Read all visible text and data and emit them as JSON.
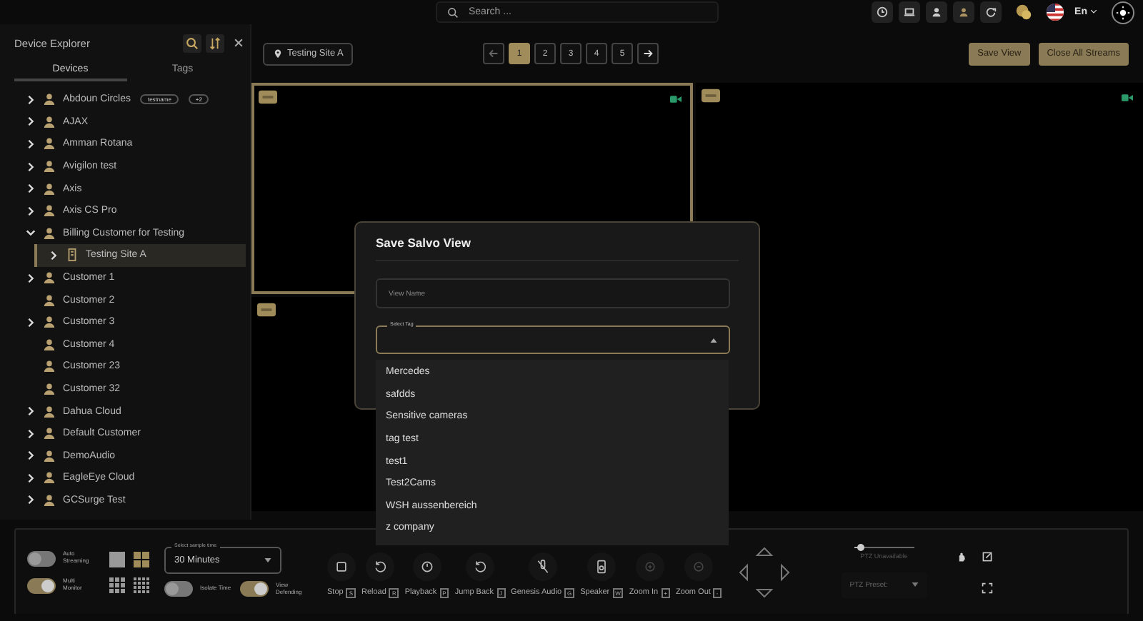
{
  "topbar": {
    "search_placeholder": "Search ...",
    "language": "En"
  },
  "sidebar": {
    "title": "Device Explorer",
    "tabs": [
      {
        "label": "Devices",
        "selected": true
      },
      {
        "label": "Tags",
        "selected": false
      }
    ],
    "tree": [
      {
        "label": "Abdoun Circles",
        "kind": "customer",
        "expandable": true,
        "expanded": false,
        "selected": false,
        "tags": [
          "testname",
          "+2"
        ]
      },
      {
        "label": "AJAX",
        "kind": "customer",
        "expandable": true,
        "expanded": false,
        "selected": false
      },
      {
        "label": "Amman Rotana",
        "kind": "customer",
        "expandable": true,
        "expanded": false,
        "selected": false
      },
      {
        "label": "Avigilon test",
        "kind": "customer",
        "expandable": true,
        "expanded": false,
        "selected": false
      },
      {
        "label": "Axis",
        "kind": "customer",
        "expandable": true,
        "expanded": false,
        "selected": false
      },
      {
        "label": "Axis CS Pro",
        "kind": "customer",
        "expandable": true,
        "expanded": false,
        "selected": false
      },
      {
        "label": "Billing Customer for Testing",
        "kind": "customer",
        "expandable": true,
        "expanded": true,
        "selected": false,
        "children": [
          {
            "label": "Testing Site A",
            "kind": "site",
            "expandable": true,
            "expanded": false,
            "selected": true
          }
        ]
      },
      {
        "label": "Customer 1",
        "kind": "customer",
        "expandable": true,
        "expanded": false,
        "selected": false
      },
      {
        "label": "Customer 2",
        "kind": "customer",
        "expandable": false,
        "expanded": false,
        "selected": false
      },
      {
        "label": "Customer 3",
        "kind": "customer",
        "expandable": true,
        "expanded": false,
        "selected": false
      },
      {
        "label": "Customer 4",
        "kind": "customer",
        "expandable": false,
        "expanded": false,
        "selected": false
      },
      {
        "label": "Customer 23",
        "kind": "customer",
        "expandable": false,
        "expanded": false,
        "selected": false
      },
      {
        "label": "Customer 32",
        "kind": "customer",
        "expandable": false,
        "expanded": false,
        "selected": false
      },
      {
        "label": "Dahua Cloud",
        "kind": "customer",
        "expandable": true,
        "expanded": false,
        "selected": false
      },
      {
        "label": "Default Customer",
        "kind": "customer",
        "expandable": true,
        "expanded": false,
        "selected": false
      },
      {
        "label": "DemoAudio",
        "kind": "customer",
        "expandable": true,
        "expanded": false,
        "selected": false
      },
      {
        "label": "EagleEye Cloud",
        "kind": "customer",
        "expandable": true,
        "expanded": false,
        "selected": false
      },
      {
        "label": "GCSurge Test",
        "kind": "customer",
        "expandable": true,
        "expanded": false,
        "selected": false
      }
    ]
  },
  "location": "Testing Site A",
  "pages": [
    {
      "label": "1",
      "selected": true
    },
    {
      "label": "2",
      "selected": false
    },
    {
      "label": "3",
      "selected": false
    },
    {
      "label": "4",
      "selected": false
    },
    {
      "label": "5",
      "selected": false
    }
  ],
  "buttons": [
    "Save View",
    "Close All Streams"
  ],
  "tiles": [
    {
      "selected": true,
      "live": true
    },
    {
      "selected": false,
      "live": true
    },
    {
      "selected": false
    }
  ],
  "modal": {
    "title": "Save Salvo View",
    "name_placeholder": "View Name",
    "tag_label": "Select Tag",
    "options": [
      "Mercedes",
      "safdds",
      "Sensitive cameras",
      "tag test",
      "test1",
      "Test2Cams",
      "WSH aussenbereich",
      "z company"
    ]
  },
  "bottom": {
    "toggles": [
      {
        "label": "Auto Streaming",
        "on": false
      },
      {
        "label": "Multi Monitor",
        "on": true
      },
      {
        "label": "Isolate Time",
        "on": false
      },
      {
        "label": "View Defending",
        "on": true
      }
    ],
    "layouts": [
      {
        "kind": "single",
        "selected": false
      },
      {
        "kind": "quad",
        "selected": true
      },
      {
        "kind": "nine",
        "selected": false
      },
      {
        "kind": "sixteen",
        "selected": false
      }
    ],
    "sample_time": {
      "label": "Select sample time",
      "value": "30 Minutes"
    },
    "actions": [
      {
        "label": "Stop",
        "key": "S",
        "kind": "stop",
        "disabled": false
      },
      {
        "label": "Reload",
        "key": "R",
        "kind": "reload",
        "disabled": false
      },
      {
        "label": "Playback",
        "key": "P",
        "kind": "playback",
        "disabled": false
      },
      {
        "label": "Jump Back",
        "key": "J",
        "kind": "jumpback",
        "disabled": false
      },
      {
        "label": "Genesis Audio",
        "key": "G",
        "kind": "audio",
        "disabled": false
      },
      {
        "label": "Speaker",
        "key": "W",
        "kind": "speaker",
        "disabled": false
      },
      {
        "label": "Zoom In",
        "key": "+",
        "kind": "zoomin",
        "disabled": true
      },
      {
        "label": "Zoom Out",
        "key": "-",
        "kind": "zoomout",
        "disabled": true
      }
    ],
    "ptz": {
      "level": 0.12,
      "status": "PTZ Unavailable",
      "preset_placeholder": "PTZ Preset:"
    }
  }
}
